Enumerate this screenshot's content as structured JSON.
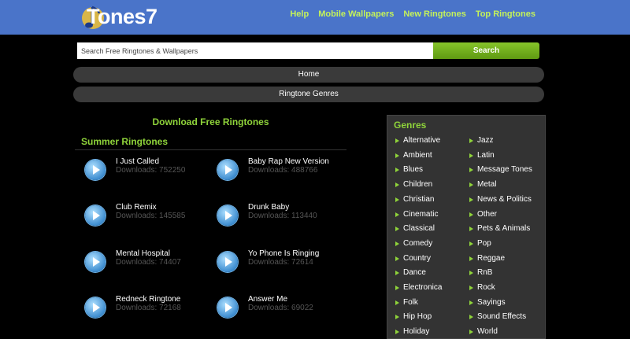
{
  "header": {
    "logo_text": "Tones7",
    "nav": [
      "Help",
      "Mobile Wallpapers",
      "New Ringtones",
      "Top Ringtones"
    ]
  },
  "search": {
    "placeholder": "Search Free Ringtones & Wallpapers",
    "button_label": "Search"
  },
  "menu": {
    "home": "Home",
    "genres": "Ringtone Genres"
  },
  "main": {
    "title": "Download Free Ringtones",
    "subtitle": "Summer Ringtones",
    "ringtones": [
      {
        "title": "I Just Called",
        "downloads": "Downloads: 752250"
      },
      {
        "title": "Baby Rap New Version",
        "downloads": "Downloads: 488766"
      },
      {
        "title": "Club Remix",
        "downloads": "Downloads: 145585"
      },
      {
        "title": "Drunk Baby",
        "downloads": "Downloads: 113440"
      },
      {
        "title": "Mental Hospital",
        "downloads": "Downloads: 74407"
      },
      {
        "title": "Yo Phone Is Ringing",
        "downloads": "Downloads: 72614"
      },
      {
        "title": "Redneck Ringtone",
        "downloads": "Downloads: 72168"
      },
      {
        "title": "Answer Me",
        "downloads": "Downloads: 69022"
      }
    ]
  },
  "genres": {
    "title": "Genres",
    "left": [
      "Alternative",
      "Ambient",
      "Blues",
      "Children",
      "Christian",
      "Cinematic",
      "Classical",
      "Comedy",
      "Country",
      "Dance",
      "Electronica",
      "Folk",
      "Hip Hop",
      "Holiday"
    ],
    "right": [
      "Jazz",
      "Latin",
      "Message Tones",
      "Metal",
      "News & Politics",
      "Other",
      "Pets & Animals",
      "Pop",
      "Reggae",
      "RnB",
      "Rock",
      "Sayings",
      "Sound Effects",
      "World"
    ]
  },
  "colors": {
    "header_bg": "#4a74c9",
    "accent_green": "#8fd43a",
    "nav_link": "#c4f25a",
    "search_button": "#6fae1c"
  }
}
